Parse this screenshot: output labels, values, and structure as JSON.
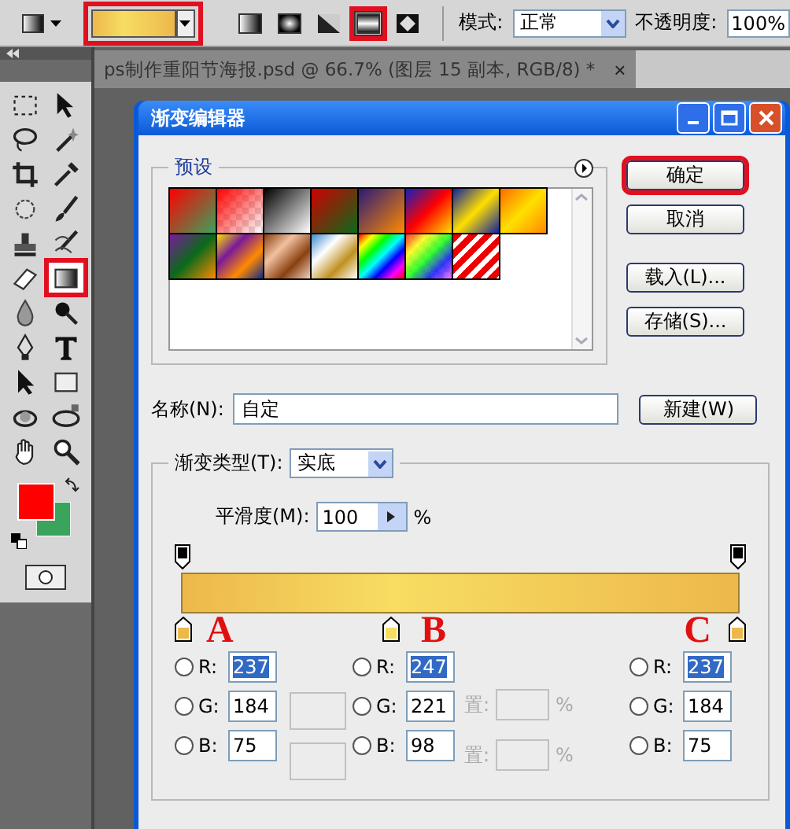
{
  "options_bar": {
    "gradient_picker": {
      "annotated": true
    },
    "gradient_types": [
      {
        "kind": "linear",
        "selected": false,
        "annotated": false
      },
      {
        "kind": "radial",
        "selected": false,
        "annotated": false
      },
      {
        "kind": "angle",
        "selected": false,
        "annotated": false
      },
      {
        "kind": "reflected",
        "selected": true,
        "annotated": true
      },
      {
        "kind": "diamond",
        "selected": false,
        "annotated": false
      }
    ],
    "mode_label": "模式:",
    "mode_value": "正常",
    "opacity_label": "不透明度:",
    "opacity_value": "100%"
  },
  "tools": [
    {
      "kind": "marquee",
      "selected": false,
      "annotated": false
    },
    {
      "kind": "move",
      "selected": false,
      "annotated": false
    },
    {
      "kind": "lasso",
      "selected": false,
      "annotated": false
    },
    {
      "kind": "wand",
      "selected": false,
      "annotated": false
    },
    {
      "kind": "crop",
      "selected": false,
      "annotated": false
    },
    {
      "kind": "eyedropper",
      "selected": false,
      "annotated": false
    },
    {
      "kind": "healing",
      "selected": false,
      "annotated": false
    },
    {
      "kind": "brush",
      "selected": false,
      "annotated": false
    },
    {
      "kind": "stamp",
      "selected": false,
      "annotated": false
    },
    {
      "kind": "history",
      "selected": false,
      "annotated": false
    },
    {
      "kind": "eraser",
      "selected": false,
      "annotated": false
    },
    {
      "kind": "gradient",
      "selected": true,
      "annotated": true
    },
    {
      "kind": "drop",
      "selected": false,
      "annotated": false
    },
    {
      "kind": "burn",
      "selected": false,
      "annotated": false
    },
    {
      "kind": "pen",
      "selected": false,
      "annotated": false
    },
    {
      "kind": "type",
      "selected": false,
      "annotated": false
    },
    {
      "kind": "select",
      "selected": false,
      "annotated": false
    },
    {
      "kind": "shape",
      "selected": false,
      "annotated": false
    },
    {
      "kind": "rotate3d",
      "selected": false,
      "annotated": false
    },
    {
      "kind": "orbit3d",
      "selected": false,
      "annotated": false
    },
    {
      "kind": "hand",
      "selected": false,
      "annotated": false
    },
    {
      "kind": "zoom",
      "selected": false,
      "annotated": false
    }
  ],
  "swatches": [
    {
      "color": "#ff0000"
    },
    {
      "color": "#3aa35c"
    }
  ],
  "document_tab": {
    "title": "ps制作重阳节海报.psd @ 66.7% (图层 15 副本, RGB/8) *",
    "close": "×"
  },
  "dialog": {
    "title": "渐变编辑器",
    "presets_label": "预设",
    "buttons": [
      {
        "label": "确定",
        "annotated": true
      },
      {
        "label": "取消",
        "annotated": false
      },
      {
        "label": "载入(L)...",
        "annotated": false
      },
      {
        "label": "存储(S)...",
        "annotated": false
      }
    ],
    "name_label": "名称(N):",
    "name_value": "自定",
    "new_button": "新建(W)",
    "type_label": "渐变类型(T):",
    "type_value": "实底",
    "smoothness_label": "平滑度(M):",
    "smoothness_value": "100",
    "smoothness_unit": "%",
    "color_stops": [
      {
        "color": "#edb84b",
        "annotation": "A"
      },
      {
        "color": "#f7dd62",
        "annotation": "B"
      },
      {
        "color": "#edb84b",
        "annotation": "C"
      }
    ],
    "color_panels": [
      {
        "fields": [
          {
            "label": "R:",
            "value": "237",
            "selected": false,
            "highlighted": true
          },
          {
            "label": "G:",
            "value": "184",
            "selected": false,
            "highlighted": false
          },
          {
            "label": "B:",
            "value": "75",
            "selected": false,
            "highlighted": false
          }
        ]
      },
      {
        "fields": [
          {
            "label": "R:",
            "value": "247",
            "selected": false,
            "highlighted": true
          },
          {
            "label": "G:",
            "value": "221",
            "selected": false,
            "highlighted": false
          },
          {
            "label": "B:",
            "value": "98",
            "selected": false,
            "highlighted": false
          }
        ]
      },
      {
        "fields": [
          {
            "label": "R:",
            "value": "237",
            "selected": false,
            "highlighted": true
          },
          {
            "label": "G:",
            "value": "184",
            "selected": false,
            "highlighted": false
          },
          {
            "label": "B:",
            "value": "75",
            "selected": false,
            "highlighted": false
          }
        ]
      }
    ],
    "location_rows": [
      {
        "label": "置:",
        "unit": "%"
      },
      {
        "label": "置:",
        "unit": "%"
      }
    ]
  }
}
